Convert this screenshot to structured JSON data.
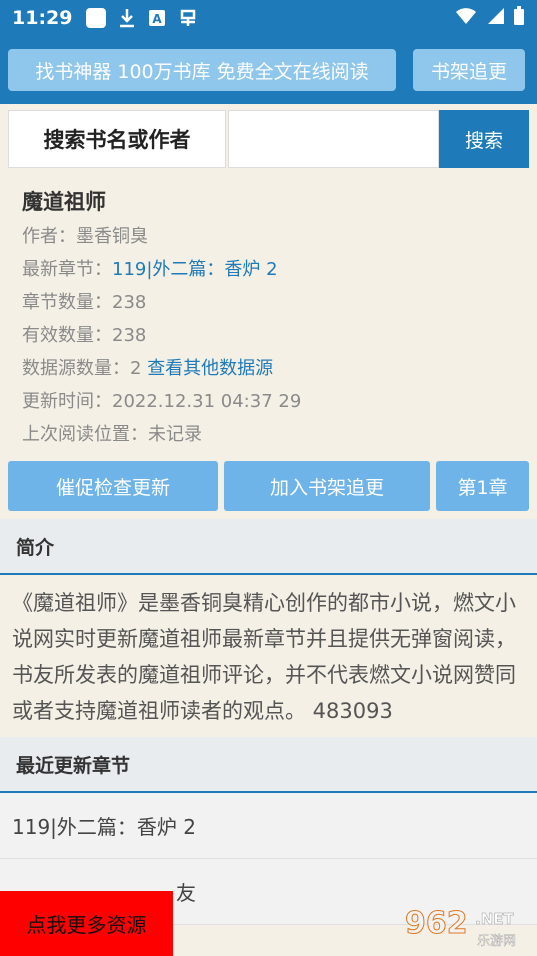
{
  "status": {
    "time": "11:29"
  },
  "topbar": {
    "left_button": "找书神器 100万书库 免费全文在线阅读",
    "right_button": "书架追更"
  },
  "search": {
    "label": "搜索书名或作者",
    "input_value": "",
    "button": "搜索"
  },
  "book": {
    "title": "魔道祖师",
    "author_label": "作者：",
    "author": "墨香铜臭",
    "latest_label": "最新章节：",
    "latest": "119|外二篇：香炉 2",
    "chapters_label": "章节数量：",
    "chapters": "238",
    "valid_label": "有效数量：",
    "valid": "238",
    "sources_label": "数据源数量：",
    "sources": "2",
    "sources_link": "查看其他数据源",
    "updated_label": "更新时间：",
    "updated": "2022.12.31 04:37 29",
    "lastread_label": "上次阅读位置：",
    "lastread": "未记录"
  },
  "actions": {
    "urge": "催促检查更新",
    "add": "加入书架追更",
    "first": "第1章"
  },
  "intro": {
    "heading": "简介",
    "text": "《魔道祖师》是墨香铜臭精心创作的都市小说，燃文小说网实时更新魔道祖师最新章节并且提供无弹窗阅读，书友所发表的魔道祖师评论，并不代表燃文小说网赞同或者支持魔道祖师读者的观点。 483093"
  },
  "recent": {
    "heading": "最近更新章节",
    "rows": [
      "119|外二篇：香炉 2",
      "友"
    ]
  },
  "promo": "点我更多资源",
  "watermark": {
    "number": "962",
    "net": ".NET",
    "cn": "乐游网"
  },
  "colors": {
    "primary": "#1e7ab8",
    "button_light": "#6eb4e8",
    "background": "#f5f0e6",
    "promo": "#ff0000"
  }
}
